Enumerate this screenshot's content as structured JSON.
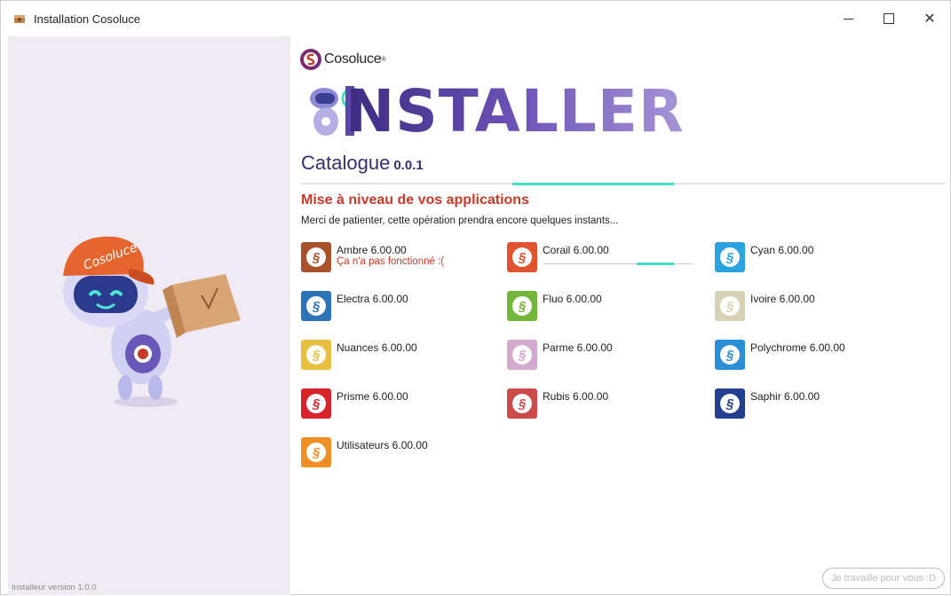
{
  "window": {
    "title": "Installation Cosoluce",
    "controls": {
      "minimize": "minimize",
      "maximize": "maximize",
      "close": "✕"
    }
  },
  "left": {
    "version_text": "Installeur version 1.0.0",
    "mascot_cap_text": "Cosoluce"
  },
  "header": {
    "brand": "Cosoluce",
    "brand_tm": "®",
    "banner_word": "NSTALLER",
    "catalogue_label": "Catalogue",
    "catalogue_version": "0.0.1",
    "progress_fraction": 0.25
  },
  "section": {
    "title": "Mise à niveau de vos applications",
    "subtitle": "Merci de patienter, cette opération prendra encore quelques instants..."
  },
  "apps": [
    {
      "name": "Ambre 6.00.00",
      "color": "#a9512a",
      "error": "Ça n'a pas fonctionné :("
    },
    {
      "name": "Corail 6.00.00",
      "color": "#e2532f",
      "progress": 0.3
    },
    {
      "name": "Cyan 6.00.00",
      "color": "#2aa3e0"
    },
    {
      "name": "Electra 6.00.00",
      "color": "#2d73b8"
    },
    {
      "name": "Fluo 6.00.00",
      "color": "#74b63a"
    },
    {
      "name": "Ivoire 6.00.00",
      "color": "#d7d2b6"
    },
    {
      "name": "Nuances 6.00.00",
      "color": "#e8bf3e"
    },
    {
      "name": "Parme 6.00.00",
      "color": "#d3a9cf"
    },
    {
      "name": "Polychrome 6.00.00",
      "color": "#2a8fd6"
    },
    {
      "name": "Prisme 6.00.00",
      "color": "#d8232a"
    },
    {
      "name": "Rubis 6.00.00",
      "color": "#cc4a4a"
    },
    {
      "name": "Saphir 6.00.00",
      "color": "#243f8f"
    },
    {
      "name": "Utilisateurs 6.00.00",
      "color": "#ef8f26"
    }
  ],
  "footer": {
    "status_pill": "Je travaille pour vous :D"
  },
  "colors": {
    "accent": "#3fe0c5",
    "heading_red": "#c83a28",
    "purple": "#3b2d73"
  }
}
